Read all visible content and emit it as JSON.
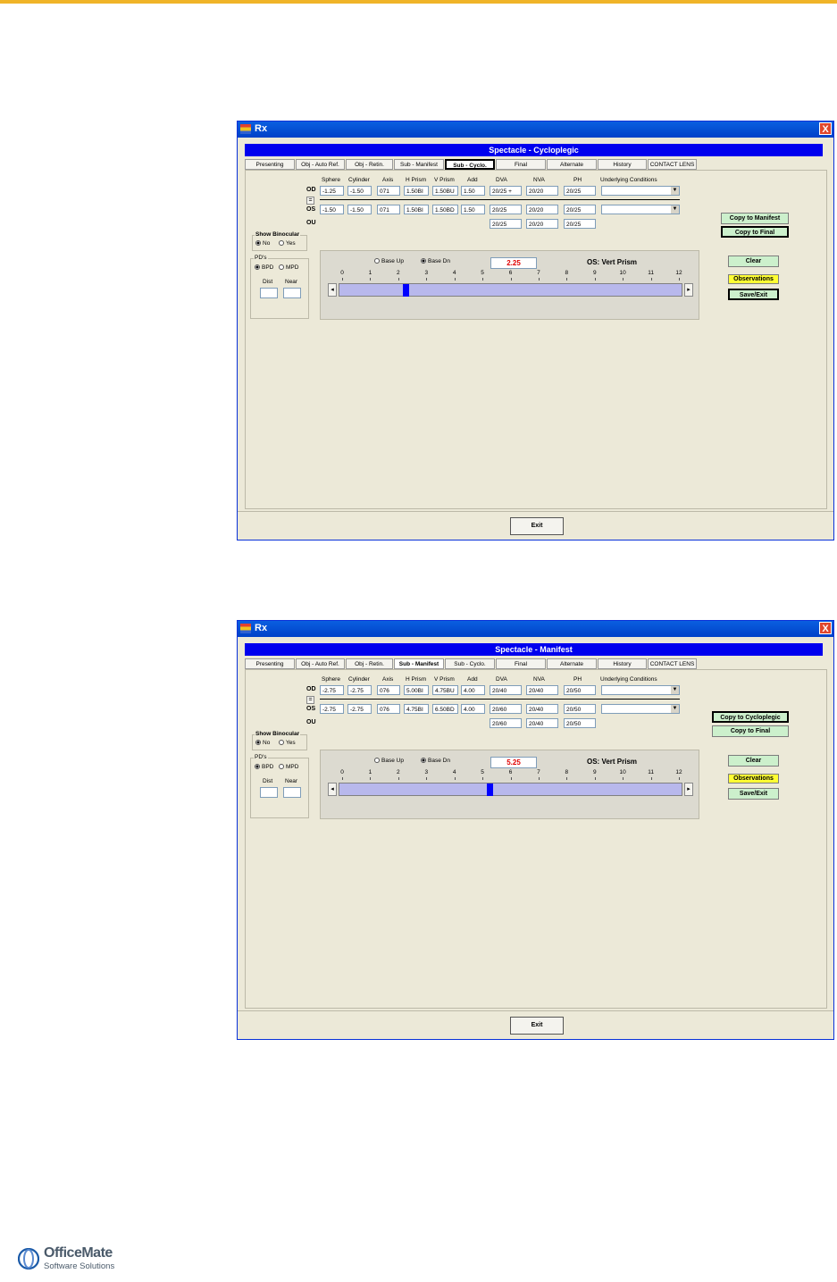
{
  "window_title": "Rx",
  "close_glyph": "X",
  "tabs": [
    "Presenting",
    "Obj - Auto Ref.",
    "Obj - Retin.",
    "Sub - Manifest",
    "Sub - Cyclo.",
    "Final",
    "Alternate",
    "History",
    "CONTACT LENS"
  ],
  "columns": [
    "Sphere",
    "Cylinder",
    "Axis",
    "H Prism",
    "V Prism",
    "Add",
    "DVA",
    "NVA",
    "PH",
    "Underlying Conditions"
  ],
  "row_labels": {
    "od": "OD",
    "os": "OS",
    "ou": "OU",
    "equal": "="
  },
  "binocular": {
    "label": "Show Binocular",
    "no": "No",
    "yes": "Yes",
    "selected": "No"
  },
  "pds": {
    "label": "PD's",
    "bpd": "BPD",
    "mpd": "MPD",
    "selected": "BPD",
    "dist": "Dist",
    "near": "Near"
  },
  "slider": {
    "base_up": "Base Up",
    "base_dn": "Base Dn",
    "selected": "Base Dn",
    "ticks": [
      "0",
      "1",
      "2",
      "3",
      "4",
      "5",
      "6",
      "7",
      "8",
      "9",
      "10",
      "11",
      "12"
    ],
    "min": 0,
    "max": 12
  },
  "buttons": {
    "copy_manifest": "Copy to Manifest",
    "copy_final": "Copy to Final",
    "copy_cyclo": "Copy to Cycloplegic",
    "clear": "Clear",
    "observations": "Observations",
    "save_exit": "Save/Exit",
    "exit": "Exit"
  },
  "panels": [
    {
      "header": "Spectacle - Cycloplegic",
      "active_tab": 4,
      "od": {
        "sphere": "-1.25",
        "cylinder": "-1.50",
        "axis": "071",
        "hprism": "1.50BI",
        "vprism": "1.50BU",
        "add": "1.50",
        "dva": "20/25 +",
        "nva": "20/20",
        "ph": "20/25"
      },
      "os": {
        "sphere": "-1.50",
        "cylinder": "-1.50",
        "axis": "071",
        "hprism": "1.50BI",
        "vprism": "1.50BD",
        "add": "1.50",
        "dva": "20/25",
        "nva": "20/20",
        "ph": "20/25"
      },
      "ou": {
        "dva": "20/25",
        "nva": "20/20",
        "ph": "20/25"
      },
      "prism_value": "2.25",
      "prism_numeric": 2.25,
      "prism_label": "OS: Vert Prism"
    },
    {
      "header": "Spectacle - Manifest",
      "active_tab": 3,
      "od": {
        "sphere": "-2.75",
        "cylinder": "-2.75",
        "axis": "076",
        "hprism": "5.00BI",
        "vprism": "4.75BU",
        "add": "4.00",
        "dva": "20/40",
        "nva": "20/40",
        "ph": "20/50"
      },
      "os": {
        "sphere": "-2.75",
        "cylinder": "-2.75",
        "axis": "076",
        "hprism": "4.75BI",
        "vprism": "6.50BD",
        "add": "4.00",
        "dva": "20/60",
        "nva": "20/40",
        "ph": "20/50"
      },
      "ou": {
        "dva": "20/60",
        "nva": "20/40",
        "ph": "20/50"
      },
      "prism_value": "5.25",
      "prism_numeric": 5.25,
      "prism_label": "OS: Vert Prism"
    }
  ],
  "logo": {
    "name": "OfficeMate",
    "sub": "Software Solutions"
  },
  "colors": {
    "accent_line": "#f0b428",
    "header_blue": "#0000ee",
    "title_blue": "#0a5fe0",
    "button_green": "#ccf0cc",
    "button_yellow": "#ffff33",
    "thumb_blue": "#0000ff"
  }
}
